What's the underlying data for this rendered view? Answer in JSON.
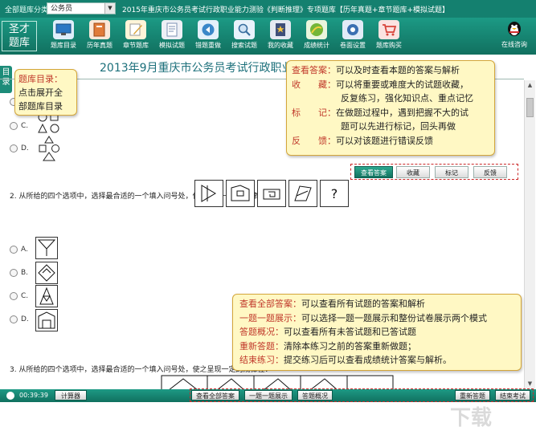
{
  "topbar": {
    "category_label": "全部题库分类",
    "category_value": "公务员",
    "title": "2015年重庆市公务员考试行政职业能力测验《判断推理》专项题库【历年真题+章节题库+模拟试题】"
  },
  "logo": {
    "line1": "圣才",
    "line2": "题库"
  },
  "toolbar": {
    "items": [
      {
        "label": "题库目录",
        "icon": "monitor-icon",
        "color": "#2b78c4"
      },
      {
        "label": "历年真题",
        "icon": "book-icon",
        "color": "#e07b39"
      },
      {
        "label": "章节题库",
        "icon": "pencil-icon",
        "color": "#d9a33a"
      },
      {
        "label": "模拟试题",
        "icon": "paper-icon",
        "color": "#7b8fb3"
      },
      {
        "label": "错题重做",
        "icon": "redo-icon",
        "color": "#3a87c9"
      },
      {
        "label": "搜索试题",
        "icon": "search-icon",
        "color": "#6fa6d8"
      },
      {
        "label": "我的收藏",
        "icon": "bookmark-icon",
        "color": "#3f4f7a"
      },
      {
        "label": "成绩统计",
        "icon": "chart-icon",
        "color": "#74b638"
      },
      {
        "label": "卷面设置",
        "icon": "gear-icon",
        "color": "#3b6fb2"
      },
      {
        "label": "题库购买",
        "icon": "cart-icon",
        "color": "#d7443a"
      }
    ],
    "consult_label": "在线咨询"
  },
  "main": {
    "sidetab": "目录",
    "exam_title": "2013年9月重庆市公务员考试行政职业能",
    "q1_options": [
      "C.",
      "D."
    ],
    "q2_text": "2. 从所给的四个选项中，选择最合适的一个填入问号处，使之呈现一定的规律性：",
    "q2_figure_question_mark": "?",
    "q2_options": [
      "A.",
      "B.",
      "C.",
      "D."
    ],
    "q3_text": "3. 从所给的四个选项中，选择最合适的一个填入问号处，使之呈现一定的规律性："
  },
  "actions": {
    "view_answer": "查看答案",
    "favorite": "收藏",
    "mark": "标记",
    "feedback": "反馈"
  },
  "tips": {
    "catalog": {
      "k": "题库目录：",
      "lines": [
        "点击展开全",
        "部题库目录"
      ]
    },
    "actions": [
      {
        "k": "查看答案：",
        "v": "可以及时查看本题的答案与解析"
      },
      {
        "k": "收　　藏：",
        "v": "可以将重要或难度大的试题收藏，"
      },
      {
        "k": "",
        "v": "反复练习，强化知识点、重点记忆"
      },
      {
        "k": "标　　记：",
        "v": "在做题过程中，遇到把握不大的试"
      },
      {
        "k": "",
        "v": "题可以先进行标记，回头再做"
      },
      {
        "k": "反　　馈：",
        "v": "可以对该题进行错误反馈"
      }
    ],
    "bottom": [
      {
        "k": "查看全部答案：",
        "v": "可以查看所有试题的答案和解析"
      },
      {
        "k": "一题一题展示：",
        "v": "可以选择一题一题展示和整份试卷展示两个模式"
      },
      {
        "k": "答题概况：",
        "v": "可以查看所有未答试题和已答试题"
      },
      {
        "k": "重新答题：",
        "v": "清除本练习之前的答案重新做题；"
      },
      {
        "k": "结束练习：",
        "v": "提交练习后可以查看成绩统计答案与解析。"
      }
    ]
  },
  "bottombar": {
    "time": "00:39:39",
    "calculator": "计算器",
    "view_all": "查看全部答案",
    "one_by_one": "一题一题展示",
    "overview": "答题概况",
    "redo": "重新答题",
    "finish": "结束考试"
  },
  "watermark": "下载"
}
